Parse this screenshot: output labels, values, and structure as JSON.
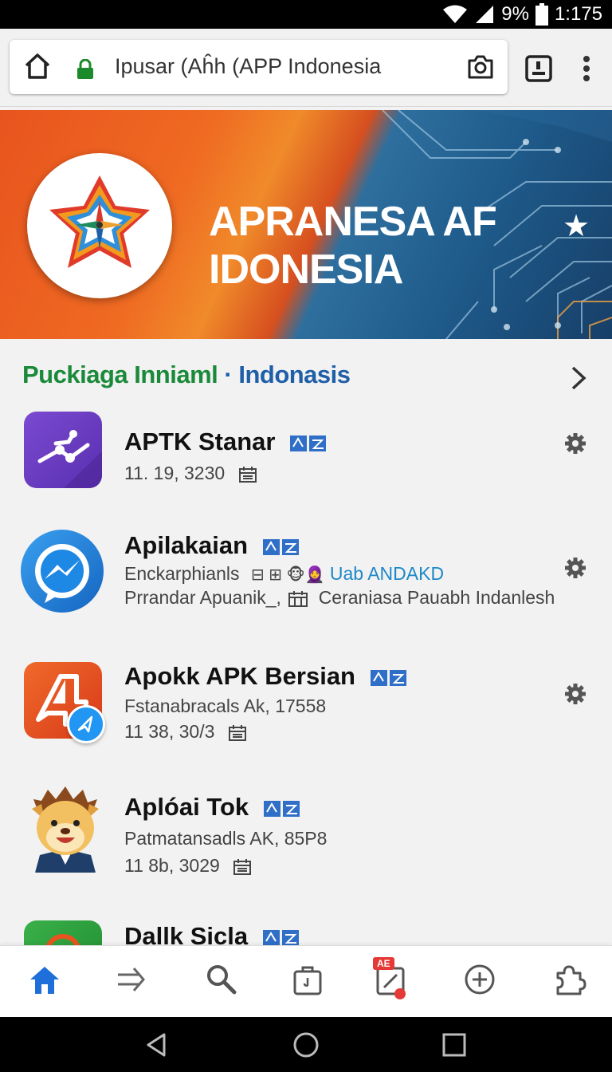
{
  "status_bar": {
    "battery": "9%",
    "time": "1:175"
  },
  "browser": {
    "url": "Ipusar (Aĥh (APP Indonesia",
    "icons": [
      "home-icon",
      "lock-icon",
      "camera-icon",
      "tab-switcher-icon",
      "more-vert-icon"
    ]
  },
  "banner": {
    "title_line1": "APRANESA AF",
    "title_line2": "IDONESIA",
    "logo": "compass-star-logo"
  },
  "section": {
    "title_part1": "Puckiaga Inniaml",
    "separator": " · ",
    "title_part2": "Indonasis"
  },
  "apps": [
    {
      "name": "APTK Stanar",
      "line1": "11. 19, 3230",
      "line2": "",
      "line2_link": "",
      "line3": "",
      "icon_color": "#6b3fc0"
    },
    {
      "name": "Apilakaian",
      "line1": "Enckarphianls",
      "line2": "Uab ANDAKD",
      "line2_link": "Uab ANDAKD",
      "line3": "Prrandar Apuanik_, ",
      "line3b": "Ceraniasa Pauabh Indanlesh",
      "icon_color": "#1e88e5"
    },
    {
      "name": "Apokk APK Bersian",
      "line1": "Fstanabracals Ak, 17558",
      "line2": "11 38, 30/3",
      "icon_color": "#e8541e"
    },
    {
      "name": "Aplóai Tok",
      "line1": "Patmatansadls AK, 85P8",
      "line2": "11 8b, 3029",
      "icon_color": "#f5c04a"
    },
    {
      "name": "Dallk Sicla",
      "line1": "",
      "line2": "",
      "icon_color": "#2e9e3e"
    }
  ],
  "bottom_nav": {
    "items": [
      "home-icon",
      "forward-icon",
      "search-icon",
      "bag-icon",
      "edit-calendar-icon",
      "add-circle-icon",
      "puzzle-icon"
    ],
    "badge_text": "AE"
  },
  "colors": {
    "accent": "#1e6fd9",
    "green": "#1a8a3a",
    "blue": "#1f5fa8"
  }
}
